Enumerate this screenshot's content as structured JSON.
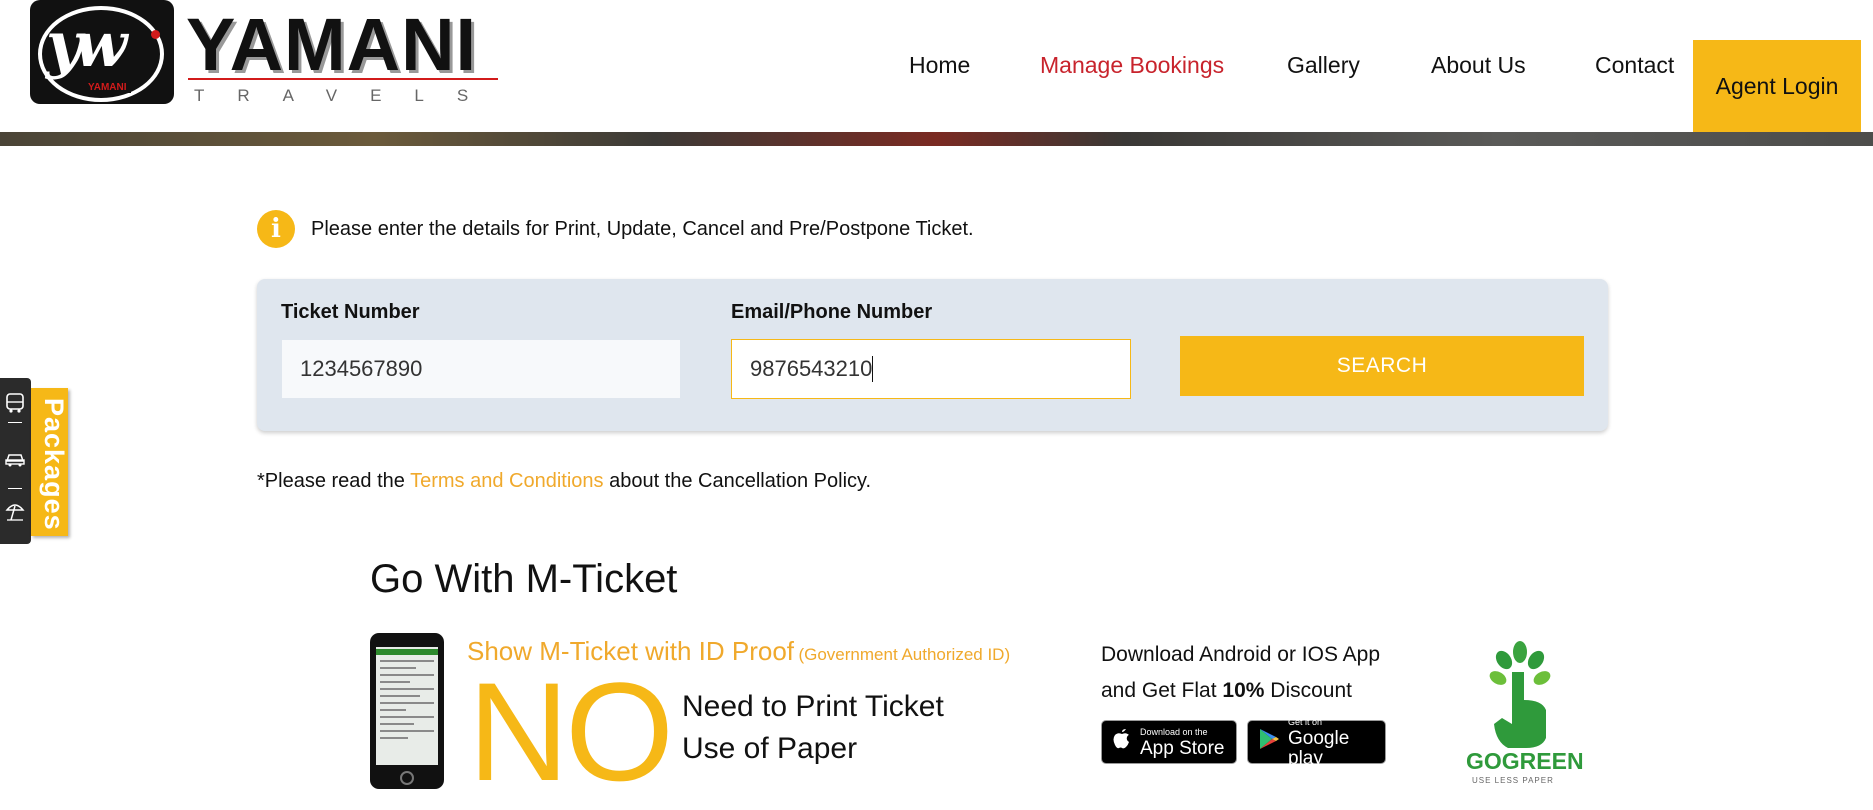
{
  "header": {
    "logo": {
      "monogram": "yw",
      "name": "YAMANI",
      "tagline": "TRAVELS",
      "mini_label": "YAMANI"
    },
    "nav": [
      {
        "label": "Home",
        "active": false
      },
      {
        "label": "Manage Bookings",
        "active": true
      },
      {
        "label": "Gallery",
        "active": false
      },
      {
        "label": "About Us",
        "active": false
      },
      {
        "label": "Contact",
        "active": false
      }
    ],
    "agent_login": "Agent Login"
  },
  "info": {
    "icon": "info-icon",
    "text": "Please enter the details for Print, Update, Cancel and Pre/Postpone Ticket."
  },
  "form": {
    "ticket_label": "Ticket Number",
    "ticket_value": "1234567890",
    "contact_label": "Email/Phone Number",
    "contact_value": "9876543210",
    "search_label": "SEARCH"
  },
  "terms": {
    "prefix": "*Please read the ",
    "link": "Terms and Conditions",
    "suffix": " about the Cancellation Policy."
  },
  "packages_tab": {
    "label": "Packages",
    "icons": [
      "bus-icon",
      "car-icon",
      "beach-umbrella-icon"
    ]
  },
  "mticket": {
    "title": "Go With M-Ticket",
    "show_main": "Show M-Ticket with ID Proof",
    "show_sub": "(Government Authorized ID)",
    "big_word": "NO",
    "need_line1": "Need to Print Ticket",
    "need_line2": "Use of Paper",
    "download_line1": "Download Android or IOS App",
    "download_line2_prefix": "and Get Flat ",
    "download_discount": "10%",
    "download_line2_suffix": " Discount",
    "app_store_small": "Download on the",
    "app_store_big": "App Store",
    "google_small": "Get it on",
    "google_big": "Google play",
    "gogreen_go": "GO",
    "gogreen_green": "GREEN",
    "gogreen_sub": "USE LESS PAPER"
  },
  "colors": {
    "accent": "#f6b817",
    "link": "#f0a92c",
    "active_nav": "#c8232c",
    "form_bg": "#dfe6ee",
    "green": "#2f9a3b"
  }
}
